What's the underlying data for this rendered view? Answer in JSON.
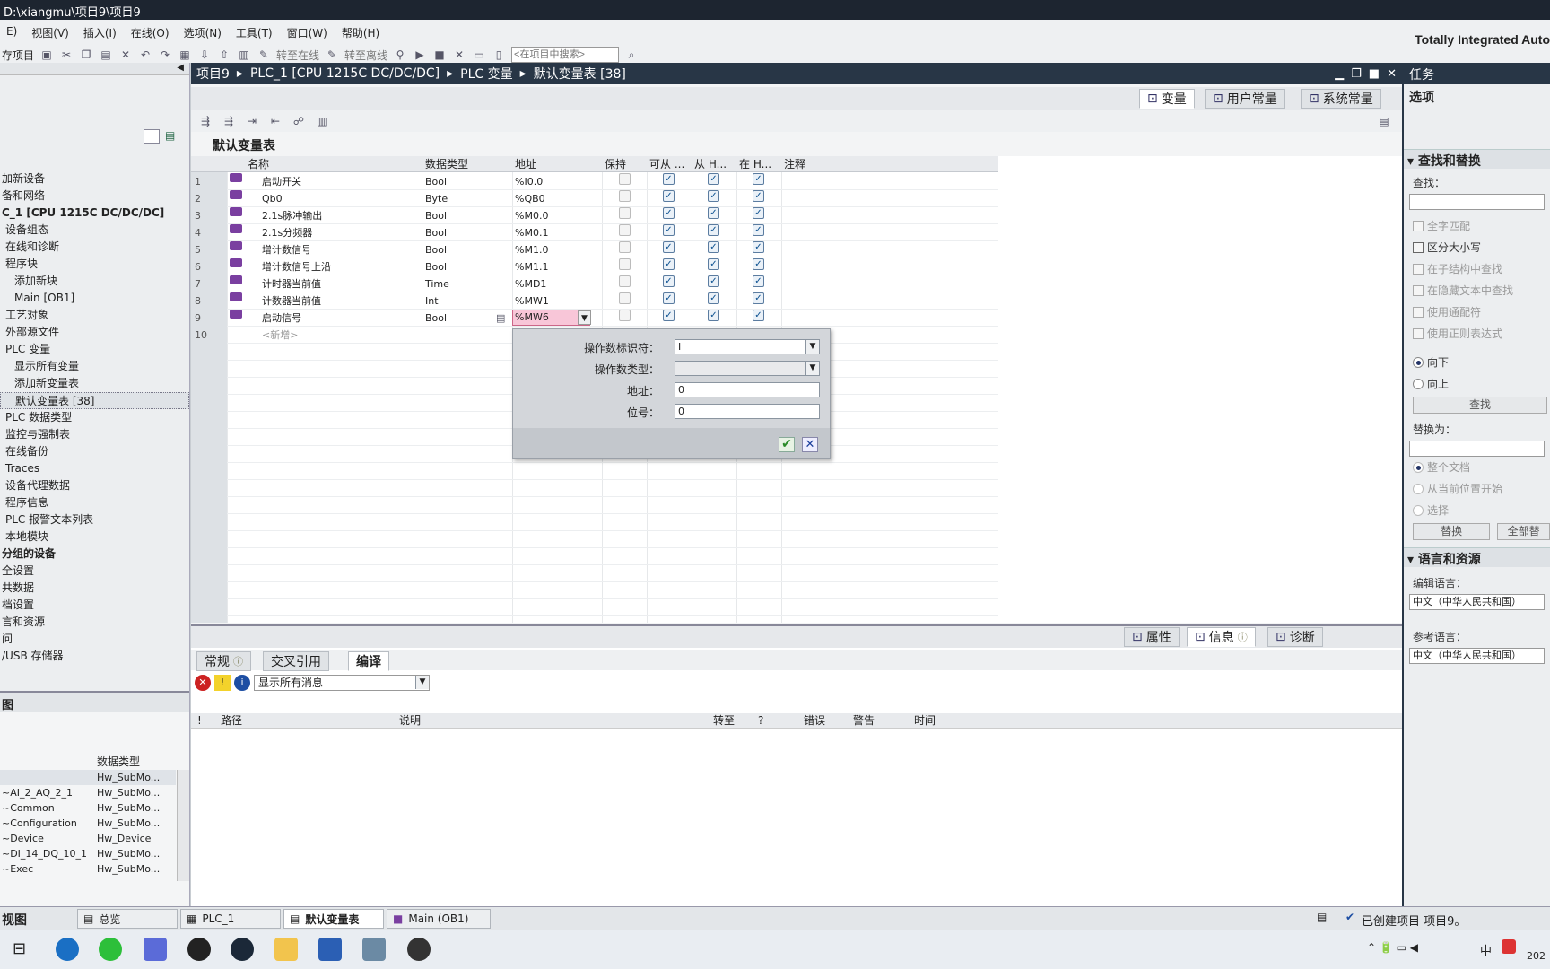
{
  "window": {
    "title": "D:\\xiangmu\\项目9\\项目9"
  },
  "menu": [
    "E)",
    "视图(V)",
    "插入(I)",
    "在线(O)",
    "选项(N)",
    "工具(T)",
    "窗口(W)",
    "帮助(H)"
  ],
  "toolbar": {
    "save_project": "存项目",
    "go_online": "转至在线",
    "go_offline": "转至离线",
    "search_placeholder": "<在项目中搜索>"
  },
  "brand": "Totally Integrated Auto",
  "project_tree": [
    {
      "label": "加新设备",
      "bold": false
    },
    {
      "label": "备和网络",
      "bold": false
    },
    {
      "label": "C_1 [CPU 1215C DC/DC/DC]",
      "bold": true
    },
    {
      "label": "设备组态",
      "bold": false
    },
    {
      "label": "在线和诊断",
      "bold": false
    },
    {
      "label": "程序块",
      "bold": false
    },
    {
      "label": "添加新块",
      "bold": false
    },
    {
      "label": "Main [OB1]",
      "bold": false
    },
    {
      "label": "工艺对象",
      "bold": false
    },
    {
      "label": "外部源文件",
      "bold": false
    },
    {
      "label": "PLC 变量",
      "bold": false
    },
    {
      "label": "显示所有变量",
      "bold": false
    },
    {
      "label": "添加新变量表",
      "bold": false
    },
    {
      "label": "默认变量表 [38]",
      "bold": false
    },
    {
      "label": "PLC 数据类型",
      "bold": false
    },
    {
      "label": "监控与强制表",
      "bold": false
    },
    {
      "label": "在线备份",
      "bold": false
    },
    {
      "label": "Traces",
      "bold": false
    },
    {
      "label": "设备代理数据",
      "bold": false
    },
    {
      "label": "程序信息",
      "bold": false
    },
    {
      "label": "PLC 报警文本列表",
      "bold": false
    },
    {
      "label": "本地模块",
      "bold": false
    },
    {
      "label": "分组的设备",
      "bold": true
    },
    {
      "label": "全设置",
      "bold": false
    },
    {
      "label": "共数据",
      "bold": false
    },
    {
      "label": "档设置",
      "bold": false
    },
    {
      "label": "言和资源",
      "bold": false
    },
    {
      "label": "问",
      "bold": false
    },
    {
      "label": "/USB 存储器",
      "bold": false
    }
  ],
  "details": {
    "title": "图",
    "col_header": "数据类型",
    "rows": [
      {
        "name": "",
        "type": "Hw_SubMo..."
      },
      {
        "name": "~AI_2_AQ_2_1",
        "type": "Hw_SubMo..."
      },
      {
        "name": "~Common",
        "type": "Hw_SubMo..."
      },
      {
        "name": "~Configuration",
        "type": "Hw_SubMo..."
      },
      {
        "name": "~Device",
        "type": "Hw_Device"
      },
      {
        "name": "~DI_14_DQ_10_1",
        "type": "Hw_SubMo..."
      },
      {
        "name": "~Exec",
        "type": "Hw_SubMo..."
      }
    ]
  },
  "breadcrumb": [
    "项目9",
    "PLC_1 [CPU 1215C DC/DC/DC]",
    "PLC 变量",
    "默认变量表 [38]"
  ],
  "view_tabs": [
    "变量",
    "用户常量",
    "系统常量"
  ],
  "table": {
    "title": "默认变量表",
    "headers": [
      "名称",
      "数据类型",
      "地址",
      "保持",
      "可从 ...",
      "从 H...",
      "在 H...",
      "注释"
    ],
    "rows": [
      {
        "n": "1",
        "name": "启动开关",
        "type": "Bool",
        "addr": "%I0.0"
      },
      {
        "n": "2",
        "name": "Qb0",
        "type": "Byte",
        "addr": "%QB0"
      },
      {
        "n": "3",
        "name": "2.1s脉冲输出",
        "type": "Bool",
        "addr": "%M0.0"
      },
      {
        "n": "4",
        "name": "2.1s分频器",
        "type": "Bool",
        "addr": "%M0.1"
      },
      {
        "n": "5",
        "name": "增计数信号",
        "type": "Bool",
        "addr": "%M1.0"
      },
      {
        "n": "6",
        "name": "增计数信号上沿",
        "type": "Bool",
        "addr": "%M1.1"
      },
      {
        "n": "7",
        "name": "计时器当前值",
        "type": "Time",
        "addr": "%MD1"
      },
      {
        "n": "8",
        "name": "计数器当前值",
        "type": "Int",
        "addr": "%MW1"
      },
      {
        "n": "9",
        "name": "启动信号",
        "type": "Bool",
        "addr": "%MW6"
      }
    ],
    "new_row_n": "10",
    "new_row_label": "<新增>"
  },
  "popup": {
    "labels": [
      "操作数标识符：",
      "操作数类型：",
      "地址：",
      "位号："
    ],
    "identifier": "I",
    "type": "",
    "address": "0",
    "bit": "0"
  },
  "bottom_tabs": [
    "属性",
    "信息",
    "诊断"
  ],
  "info_tabs": [
    "常规",
    "交叉引用",
    "编译"
  ],
  "message_filter": "显示所有消息",
  "message_headers": [
    "!",
    "路径",
    "说明",
    "转至",
    "?",
    "错误",
    "警告",
    "时间"
  ],
  "right_panel": {
    "title": "任务",
    "options": "选项",
    "find_replace": "查找和替换",
    "find_label": "查找：",
    "checkboxes": [
      "全字匹配",
      "区分大小写",
      "在子结构中查找",
      "在隐藏文本中查找",
      "使用通配符",
      "使用正则表达式"
    ],
    "direction": [
      "向下",
      "向上"
    ],
    "find_btn": "查找",
    "replace_label": "替换为：",
    "scope": [
      "整个文档",
      "从当前位置开始",
      "选择"
    ],
    "replace_btn": "替换",
    "replace_all_btn": "全部替",
    "lang_section": "语言和资源",
    "edit_lang_label": "编辑语言：",
    "edit_lang": "中文（中华人民共和国）",
    "ref_lang_label": "参考语言：",
    "ref_lang": "中文（中华人民共和国）"
  },
  "statusbar": {
    "view": "视图",
    "tabs": [
      "总览",
      "PLC_1",
      "默认变量表",
      "Main (OB1)"
    ],
    "message": "已创建项目 项目9。"
  },
  "taskbar": {
    "tray_lang": "中",
    "clock_year": "202"
  }
}
